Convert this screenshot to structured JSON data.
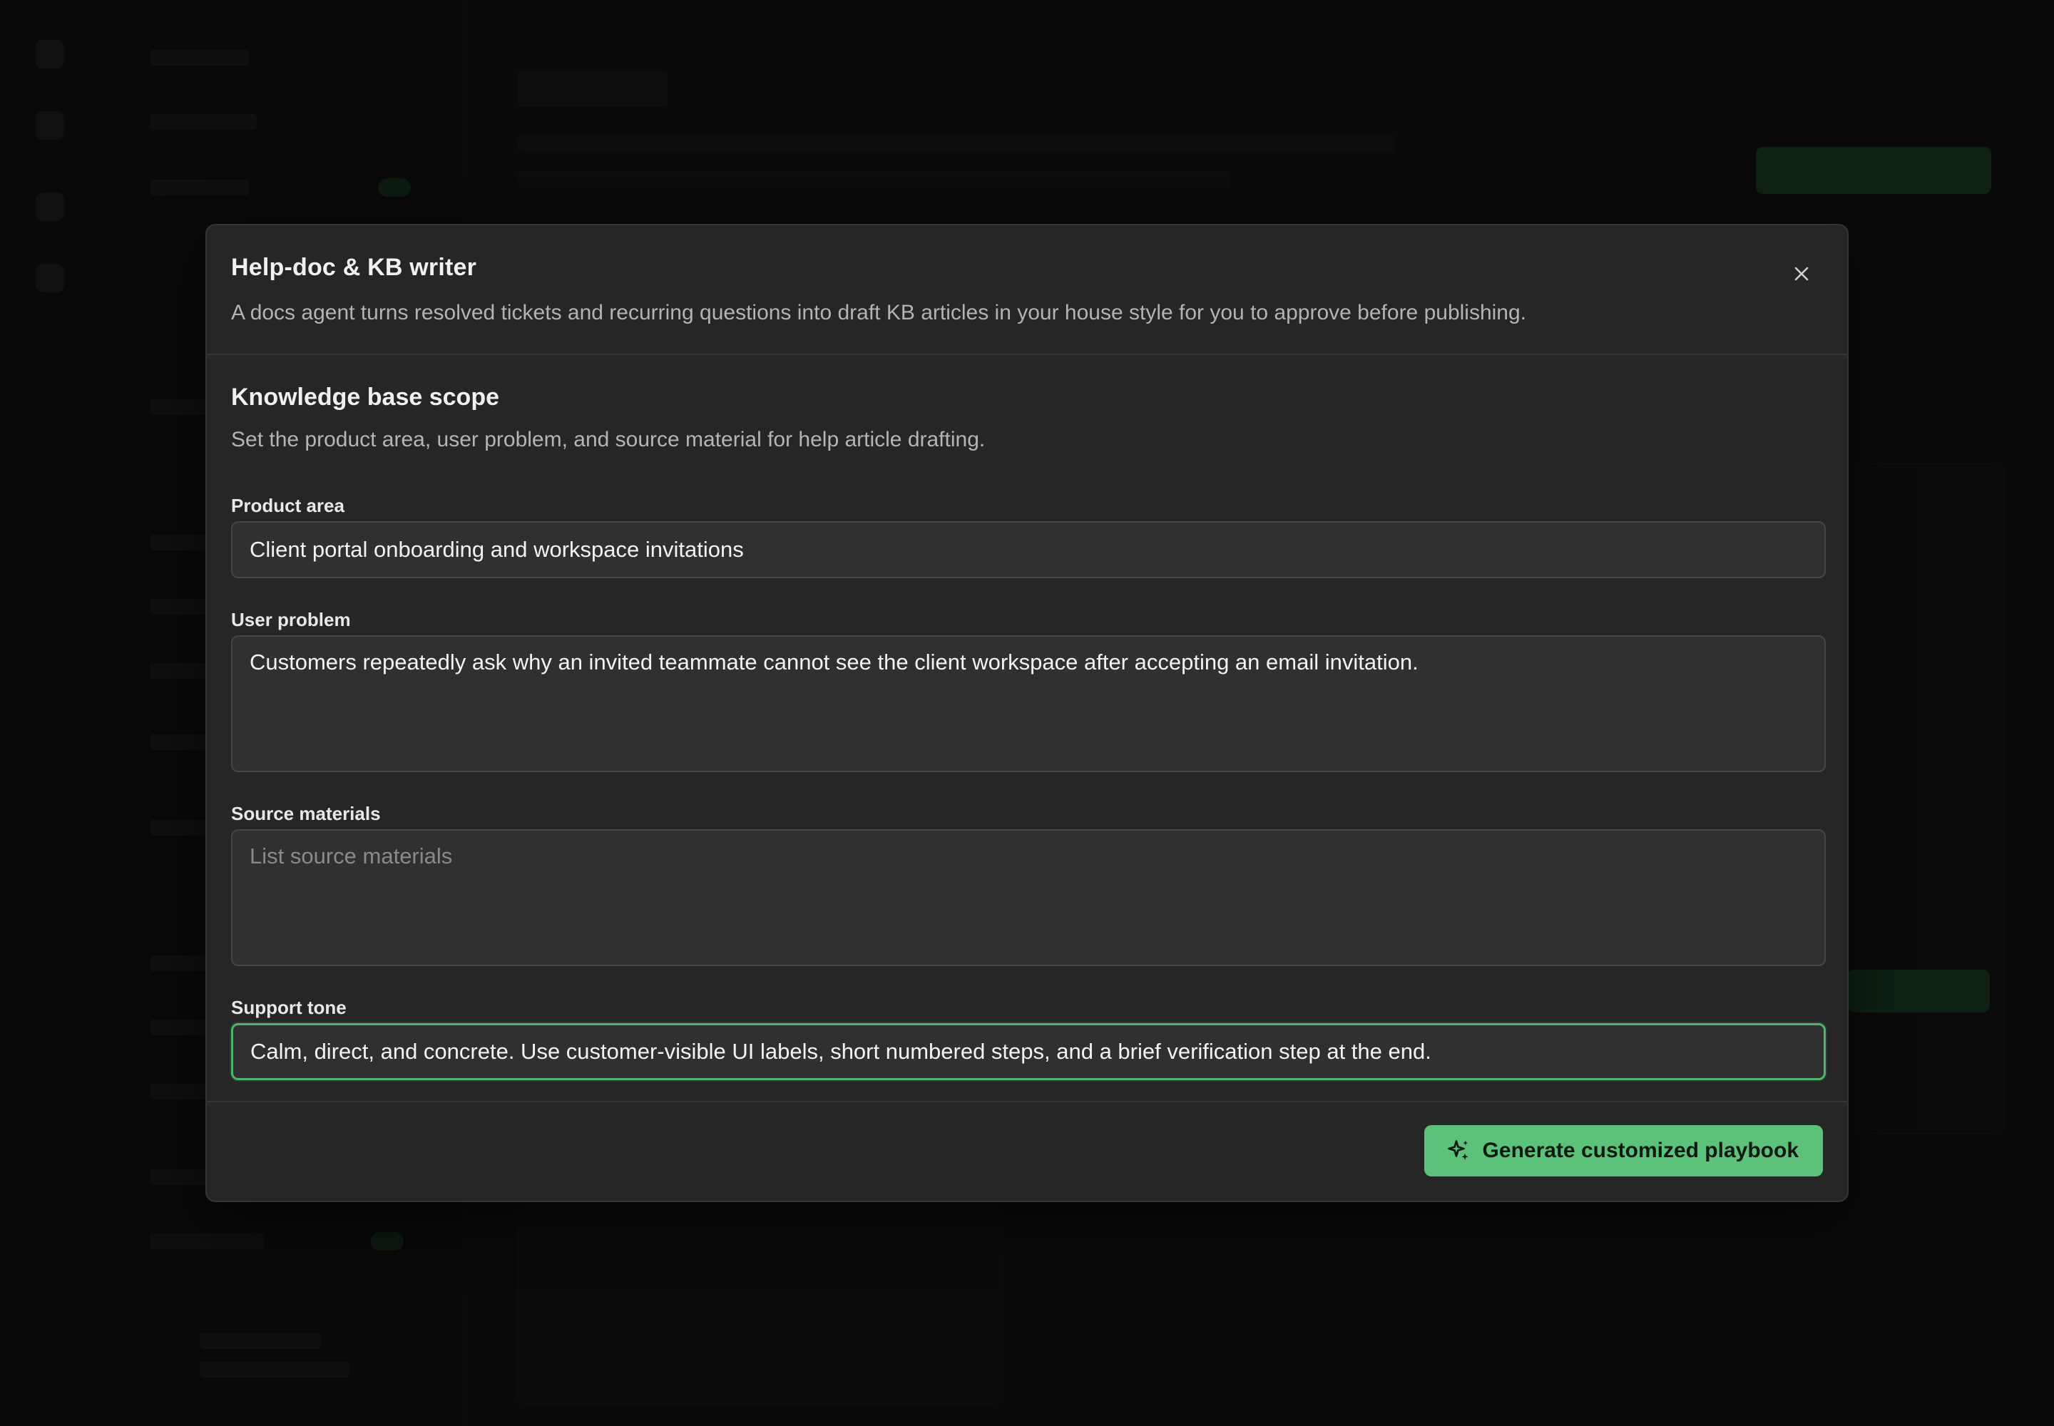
{
  "modal": {
    "title": "Help-doc & KB writer",
    "description": "A docs agent turns resolved tickets and recurring questions into draft KB articles in your house style for you to approve before publishing.",
    "close_icon": "close-icon"
  },
  "section": {
    "title": "Knowledge base scope",
    "description": "Set the product area, user problem, and source material for help article drafting."
  },
  "fields": {
    "product_area": {
      "label": "Product area",
      "value": "Client portal onboarding and workspace invitations"
    },
    "user_problem": {
      "label": "User problem",
      "value": "Customers repeatedly ask why an invited teammate cannot see the client workspace after accepting an email invitation."
    },
    "source_materials": {
      "label": "Source materials",
      "value": "",
      "placeholder": "List source materials"
    },
    "support_tone": {
      "label": "Support tone",
      "value": "Calm, direct, and concrete. Use customer-visible UI labels, short numbered steps, and a brief verification step at the end."
    }
  },
  "footer": {
    "generate_label": "Generate customized playbook",
    "generate_icon": "sparkles-icon"
  },
  "colors": {
    "accent": "#5cc27a",
    "focus_border": "#4fb56a",
    "modal_bg": "#262626",
    "backdrop": "#131313"
  }
}
